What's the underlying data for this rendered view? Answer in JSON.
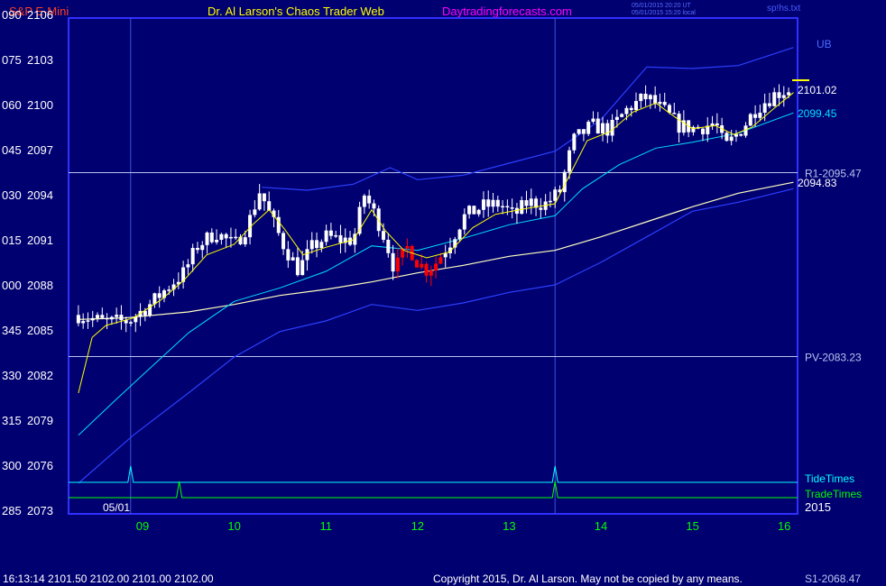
{
  "header": {
    "instrument": "S&P E-Mini",
    "title": "Dr. Al Larson's Chaos Trader Web",
    "site": "Daytradingforecasts.com",
    "date_ut": "05/01/2015 20:20 UT",
    "date_local": "05/01/2015 15:20 local",
    "file": "sp!hs.txt"
  },
  "footer": {
    "quote": "16:13:14  2101.50 2102.00 2101.00 2102.00",
    "copyright": "Copyright 2015, Dr. Al Larson. May not be copied by any means.",
    "s1_label": "S1-2068.47"
  },
  "colors": {
    "background": "#000070",
    "frame": "#3030ff",
    "grid": "#3f53d8",
    "level_lines": "#b8c4ec",
    "price_bars": "#ffffff",
    "down_bars": "#ff0000",
    "fast_avg": "#ffff00",
    "mid_avg": "#00e0ff",
    "slow_avg": "#ffffc0",
    "band": "#2b40ff",
    "tide": "#00ffff",
    "trade": "#00ff00",
    "title_red": "#ff4020",
    "title_yellow": "#ffff00",
    "title_magenta": "#ff00ff"
  },
  "chart_data": {
    "type": "candlestick",
    "title": "S&P E-Mini",
    "ylim": [
      2073,
      2106
    ],
    "y_ticks": [
      {
        "value": 2073,
        "left": "285"
      },
      {
        "value": 2076,
        "left": "300"
      },
      {
        "value": 2079,
        "left": "315"
      },
      {
        "value": 2082,
        "left": "330"
      },
      {
        "value": 2085,
        "left": "345"
      },
      {
        "value": 2088,
        "left": "000"
      },
      {
        "value": 2091,
        "left": "015"
      },
      {
        "value": 2094,
        "left": "030"
      },
      {
        "value": 2097,
        "left": "045"
      },
      {
        "value": 2100,
        "left": "060"
      },
      {
        "value": 2103,
        "left": "075"
      },
      {
        "value": 2106,
        "left": "090"
      }
    ],
    "xlim": [
      8.3,
      16.1
    ],
    "x_ticks": [
      {
        "value": 9,
        "label": "09"
      },
      {
        "value": 10,
        "label": "10"
      },
      {
        "value": 11,
        "label": "11"
      },
      {
        "value": 12,
        "label": "12"
      },
      {
        "value": 13,
        "label": "13"
      },
      {
        "value": 14,
        "label": "14"
      },
      {
        "value": 15,
        "label": "15"
      },
      {
        "value": 16,
        "label": "16"
      }
    ],
    "date_label": "05/01",
    "year_label": "2015",
    "ub_label": "UB",
    "vertical_markers": [
      8.87,
      13.5
    ],
    "levels": [
      {
        "name": "R1",
        "label": "R1-2095.47",
        "value": 2095.47
      },
      {
        "name": "PV",
        "label": "PV-2083.23",
        "value": 2083.23
      }
    ],
    "last_values": [
      {
        "label": "2101.02",
        "value": 2101.02,
        "color": "#ffffff"
      },
      {
        "label": "2099.45",
        "value": 2099.45,
        "color": "#00e0ff"
      },
      {
        "label": "2094.83",
        "value": 2094.83,
        "color": "#ffffff"
      }
    ],
    "price_path": [
      [
        8.3,
        2086.0
      ],
      [
        8.6,
        2085.5
      ],
      [
        8.85,
        2085.6
      ],
      [
        9.1,
        2086.8
      ],
      [
        9.3,
        2088.0
      ],
      [
        9.45,
        2088.8
      ],
      [
        9.6,
        2090.6
      ],
      [
        9.8,
        2091.5
      ],
      [
        10.0,
        2090.6
      ],
      [
        10.15,
        2092.0
      ],
      [
        10.28,
        2094.3
      ],
      [
        10.4,
        2092.5
      ],
      [
        10.55,
        2090.5
      ],
      [
        10.7,
        2089.0
      ],
      [
        10.85,
        2090.5
      ],
      [
        11.0,
        2091.2
      ],
      [
        11.15,
        2091.0
      ],
      [
        11.3,
        2091.0
      ],
      [
        11.42,
        2094.0
      ],
      [
        11.55,
        2092.5
      ],
      [
        11.65,
        2091.0
      ],
      [
        11.75,
        2089.0
      ],
      [
        11.9,
        2090.6
      ],
      [
        12.0,
        2089.5
      ],
      [
        12.1,
        2089.0
      ],
      [
        12.2,
        2089.5
      ],
      [
        12.35,
        2090.8
      ],
      [
        12.5,
        2092.5
      ],
      [
        12.7,
        2093.2
      ],
      [
        12.9,
        2093.4
      ],
      [
        13.05,
        2092.6
      ],
      [
        13.2,
        2093.5
      ],
      [
        13.4,
        2093.4
      ],
      [
        13.55,
        2094.2
      ],
      [
        13.7,
        2097.6
      ],
      [
        13.9,
        2098.6
      ],
      [
        14.1,
        2098.3
      ],
      [
        14.3,
        2099.8
      ],
      [
        14.5,
        2100.5
      ],
      [
        14.7,
        2099.5
      ],
      [
        14.85,
        2098.6
      ],
      [
        15.05,
        2098.4
      ],
      [
        15.25,
        2098.8
      ],
      [
        15.35,
        2097.1
      ],
      [
        15.55,
        2098.5
      ],
      [
        15.7,
        2099.8
      ],
      [
        15.9,
        2100.7
      ],
      [
        16.05,
        2101.02
      ]
    ],
    "red_range": [
      11.78,
      12.28
    ],
    "fast_avg": [
      [
        8.3,
        2080.8
      ],
      [
        8.45,
        2084.5
      ],
      [
        8.6,
        2085.3
      ],
      [
        8.9,
        2085.8
      ],
      [
        9.2,
        2087.0
      ],
      [
        9.45,
        2088.3
      ],
      [
        9.7,
        2090.0
      ],
      [
        10.0,
        2090.7
      ],
      [
        10.2,
        2092.0
      ],
      [
        10.38,
        2093.0
      ],
      [
        10.55,
        2091.7
      ],
      [
        10.75,
        2090.0
      ],
      [
        11.0,
        2090.5
      ],
      [
        11.3,
        2091.0
      ],
      [
        11.5,
        2093.0
      ],
      [
        11.65,
        2091.6
      ],
      [
        11.85,
        2090.3
      ],
      [
        12.1,
        2089.8
      ],
      [
        12.35,
        2090.2
      ],
      [
        12.6,
        2091.8
      ],
      [
        12.85,
        2092.7
      ],
      [
        13.2,
        2093.1
      ],
      [
        13.5,
        2093.4
      ],
      [
        13.65,
        2095.2
      ],
      [
        13.85,
        2097.6
      ],
      [
        14.1,
        2098.2
      ],
      [
        14.35,
        2099.5
      ],
      [
        14.6,
        2100.1
      ],
      [
        14.8,
        2099.2
      ],
      [
        15.0,
        2098.4
      ],
      [
        15.25,
        2098.6
      ],
      [
        15.45,
        2098.0
      ],
      [
        15.65,
        2098.5
      ],
      [
        15.9,
        2099.8
      ],
      [
        16.1,
        2100.8
      ]
    ],
    "mid_avg": [
      [
        8.3,
        2078.0
      ],
      [
        8.7,
        2080.3
      ],
      [
        9.0,
        2082.0
      ],
      [
        9.5,
        2084.8
      ],
      [
        10.0,
        2086.9
      ],
      [
        10.5,
        2087.8
      ],
      [
        11.0,
        2088.9
      ],
      [
        11.5,
        2090.6
      ],
      [
        12.0,
        2090.3
      ],
      [
        12.5,
        2091.1
      ],
      [
        13.0,
        2092.0
      ],
      [
        13.5,
        2092.6
      ],
      [
        13.8,
        2094.4
      ],
      [
        14.2,
        2096.0
      ],
      [
        14.6,
        2097.1
      ],
      [
        15.0,
        2097.5
      ],
      [
        15.5,
        2098.1
      ],
      [
        16.1,
        2099.45
      ]
    ],
    "slow_avg": [
      [
        8.3,
        2085.7
      ],
      [
        8.8,
        2085.8
      ],
      [
        9.5,
        2086.2
      ],
      [
        10.0,
        2086.7
      ],
      [
        10.5,
        2087.3
      ],
      [
        11.0,
        2087.7
      ],
      [
        11.5,
        2088.2
      ],
      [
        12.0,
        2088.8
      ],
      [
        12.5,
        2089.3
      ],
      [
        13.0,
        2089.9
      ],
      [
        13.5,
        2090.3
      ],
      [
        14.0,
        2091.2
      ],
      [
        14.5,
        2092.2
      ],
      [
        15.0,
        2093.2
      ],
      [
        15.5,
        2094.1
      ],
      [
        16.1,
        2094.83
      ]
    ],
    "upper_band": [
      [
        10.3,
        2094.5
      ],
      [
        10.8,
        2094.3
      ],
      [
        11.3,
        2094.7
      ],
      [
        11.7,
        2095.8
      ],
      [
        12.0,
        2095.0
      ],
      [
        12.5,
        2095.3
      ],
      [
        13.0,
        2096.1
      ],
      [
        13.5,
        2096.9
      ],
      [
        14.0,
        2099.0
      ],
      [
        14.5,
        2102.5
      ],
      [
        15.0,
        2102.4
      ],
      [
        15.5,
        2102.6
      ],
      [
        16.1,
        2103.8
      ]
    ],
    "lower_band": [
      [
        8.3,
        2074.8
      ],
      [
        8.9,
        2078.0
      ],
      [
        9.5,
        2080.8
      ],
      [
        10.0,
        2083.2
      ],
      [
        10.5,
        2084.9
      ],
      [
        11.0,
        2085.6
      ],
      [
        11.5,
        2086.7
      ],
      [
        12.0,
        2086.3
      ],
      [
        12.5,
        2086.8
      ],
      [
        13.0,
        2087.5
      ],
      [
        13.5,
        2088.0
      ],
      [
        14.0,
        2089.5
      ],
      [
        14.5,
        2091.2
      ],
      [
        15.0,
        2092.9
      ],
      [
        15.5,
        2093.5
      ],
      [
        16.1,
        2094.4
      ]
    ],
    "tide_times": {
      "label": "TideTimes",
      "spikes": [
        8.87,
        13.5
      ]
    },
    "trade_times": {
      "label": "TradeTimes",
      "spikes": [
        9.4,
        13.5
      ]
    }
  }
}
